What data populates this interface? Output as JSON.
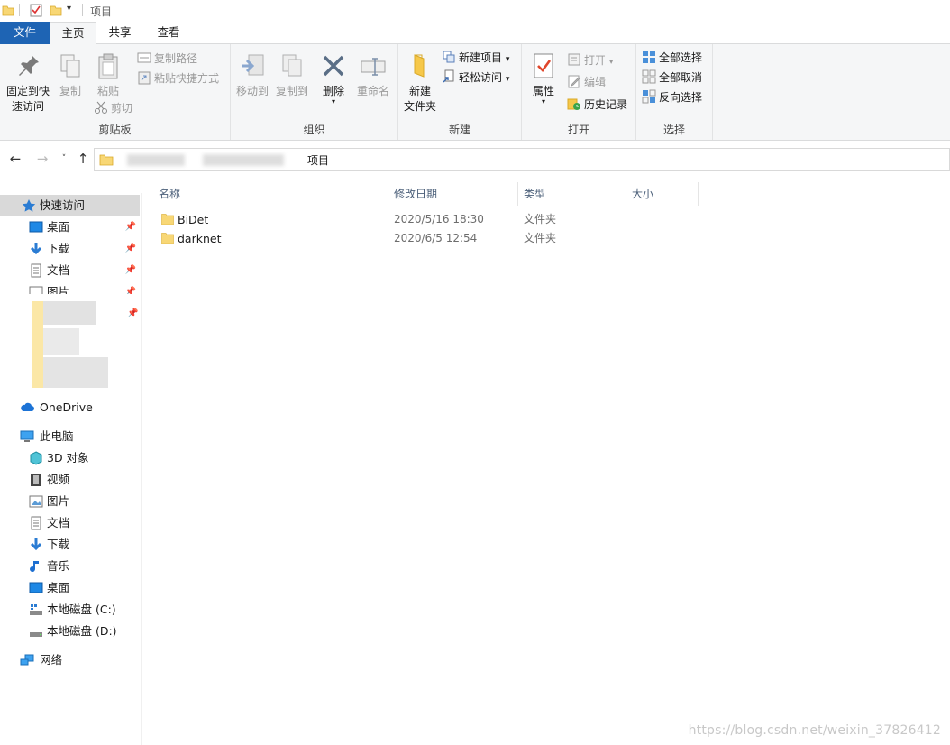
{
  "titlebar": {
    "title": "项目"
  },
  "tabs": [
    {
      "label": "文件"
    },
    {
      "label": "主页"
    },
    {
      "label": "共享"
    },
    {
      "label": "查看"
    }
  ],
  "ribbon": {
    "clipboard": {
      "label": "剪贴板",
      "pin": "固定到快",
      "pin2": "速访问",
      "copy": "复制",
      "paste": "粘贴",
      "copy_path": "复制路径",
      "paste_shortcut": "粘贴快捷方式",
      "cut": "剪切"
    },
    "organize": {
      "label": "组织",
      "move_to": "移动到",
      "copy_to": "复制到",
      "delete": "删除",
      "rename": "重命名"
    },
    "new": {
      "label": "新建",
      "new_folder": "新建",
      "new_folder2": "文件夹",
      "new_item": "新建项目",
      "easy_access": "轻松访问"
    },
    "open": {
      "label": "打开",
      "properties": "属性",
      "open": "打开",
      "edit": "编辑",
      "history": "历史记录"
    },
    "select": {
      "label": "选择",
      "select_all": "全部选择",
      "select_none": "全部取消",
      "invert": "反向选择"
    }
  },
  "address": {
    "current": "项目"
  },
  "navpane": {
    "quick_access": "快速访问",
    "qa_items": [
      "桌面",
      "下载",
      "文档",
      "图片"
    ],
    "onedrive": "OneDrive",
    "this_pc": "此电脑",
    "pc_items": [
      "3D 对象",
      "视频",
      "图片",
      "文档",
      "下载",
      "音乐",
      "桌面",
      "本地磁盘 (C:)",
      "本地磁盘 (D:)"
    ],
    "network": "网络"
  },
  "columns": {
    "name": "名称",
    "modified": "修改日期",
    "type": "类型",
    "size": "大小"
  },
  "files": [
    {
      "name": "BiDet",
      "modified": "2020/5/16 18:30",
      "type": "文件夹"
    },
    {
      "name": "darknet",
      "modified": "2020/6/5 12:54",
      "type": "文件夹"
    }
  ],
  "watermark": "https://blog.csdn.net/weixin_37826412",
  "colors": {
    "accent": "#1e64b4",
    "folder": "#f8d775",
    "selected": "#d9d9d9"
  }
}
